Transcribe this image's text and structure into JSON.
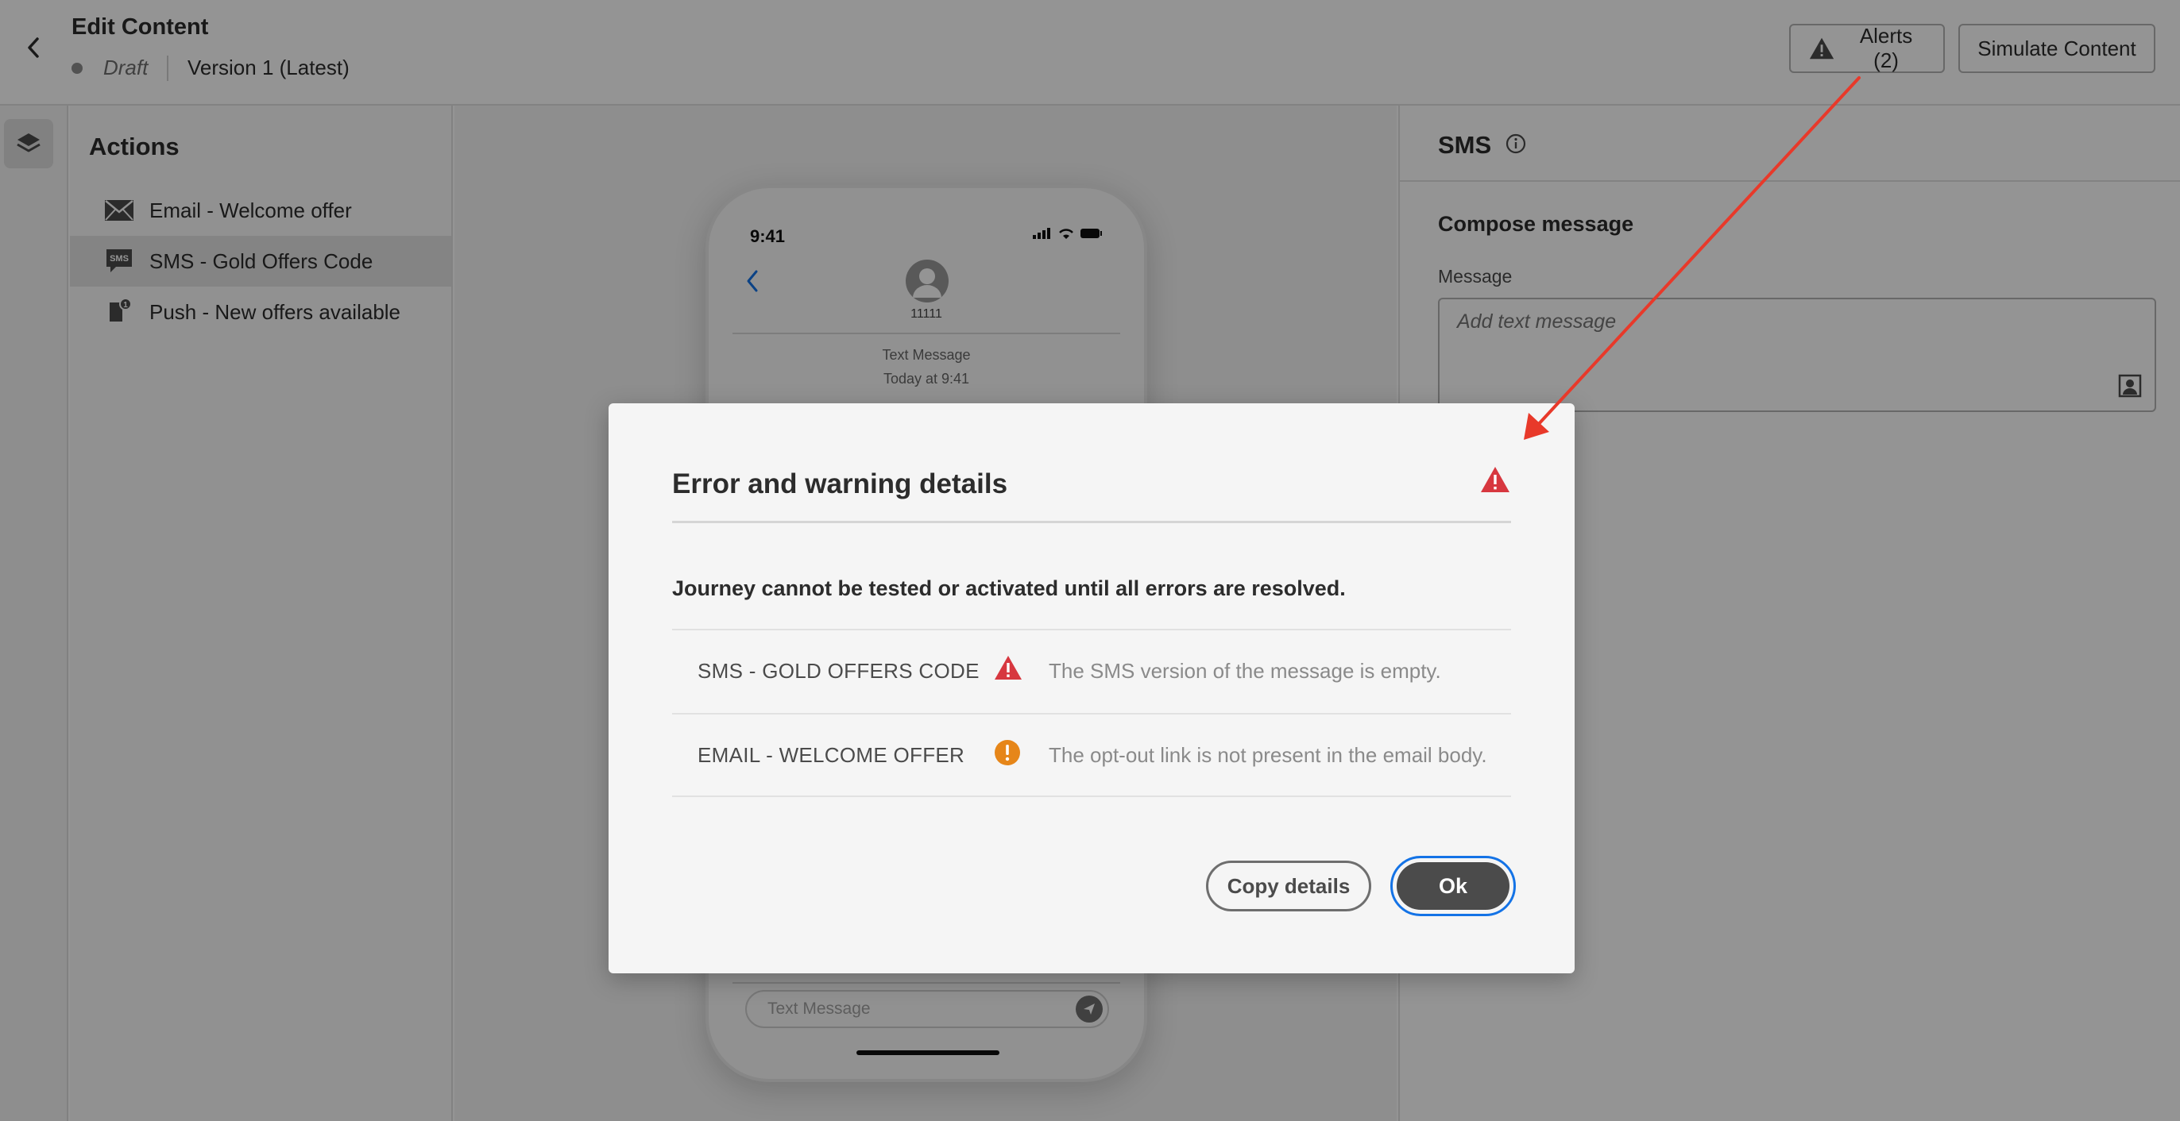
{
  "header": {
    "title": "Edit Content",
    "status": "Draft",
    "version": "Version 1 (Latest)",
    "alerts_label": "Alerts (2)",
    "simulate_label": "Simulate Content"
  },
  "actions": {
    "title": "Actions",
    "items": [
      {
        "label": "Email - Welcome offer",
        "icon": "email-icon"
      },
      {
        "label": "SMS - Gold Offers Code",
        "icon": "sms-icon",
        "selected": true
      },
      {
        "label": "Push - New offers available",
        "icon": "push-icon"
      }
    ]
  },
  "phone": {
    "time": "9:41",
    "contact": "11111",
    "message_label": "Text Message",
    "message_time": "Today at 9:41",
    "input_placeholder": "Text Message"
  },
  "sms_panel": {
    "title": "SMS",
    "compose_title": "Compose message",
    "message_label": "Message",
    "message_placeholder": "Add text message"
  },
  "modal": {
    "title": "Error and warning details",
    "subtitle": "Journey cannot be tested or activated until all errors are resolved.",
    "rows": [
      {
        "name": "SMS - GOLD OFFERS CODE",
        "severity": "error",
        "message": "The SMS version of the message is empty."
      },
      {
        "name": "EMAIL - WELCOME OFFER",
        "severity": "warning",
        "message": "The opt-out link is not present in the email body."
      }
    ],
    "copy_label": "Copy details",
    "ok_label": "Ok"
  },
  "colors": {
    "error": "#d7373f",
    "warning": "#e68619",
    "focus": "#1473e6",
    "annotation": "#e8392a"
  }
}
